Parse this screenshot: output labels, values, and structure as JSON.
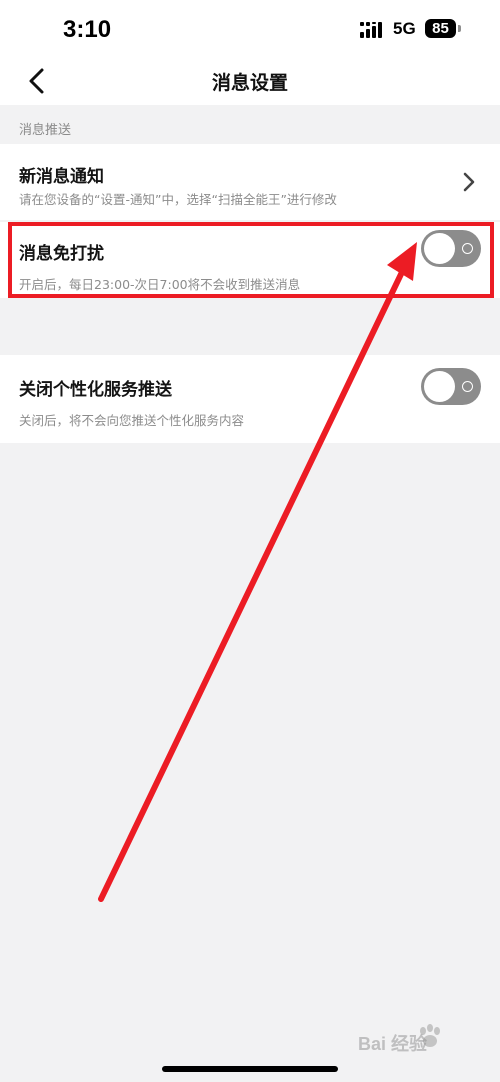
{
  "status_bar": {
    "time": "3:10",
    "network": "5G",
    "battery": "85",
    "signal_icon": "cellular-signal-icon"
  },
  "nav": {
    "title": "消息设置",
    "back_icon": "chevron-left-icon"
  },
  "section": {
    "header": "消息推送"
  },
  "rows": [
    {
      "title": "新消息通知",
      "subtitle": "请在您设备的“设置-通知”中，选择“扫描全能王”进行修改",
      "control": "chevron-right-icon"
    },
    {
      "title": "消息免打扰",
      "subtitle": "开启后，每日23:00-次日7:00将不会收到推送消息",
      "control": "toggle",
      "enabled": false
    },
    {
      "title": "关闭个性化服务推送",
      "subtitle": "关闭后，将不会向您推送个性化服务内容",
      "control": "toggle",
      "enabled": false
    }
  ],
  "annotation": {
    "color": "#ec1c24"
  },
  "watermark": {
    "text": "Bai 经验"
  },
  "colors": {
    "page_bg": "#f2f2f3",
    "toggle_off": "#8c8c8c"
  }
}
